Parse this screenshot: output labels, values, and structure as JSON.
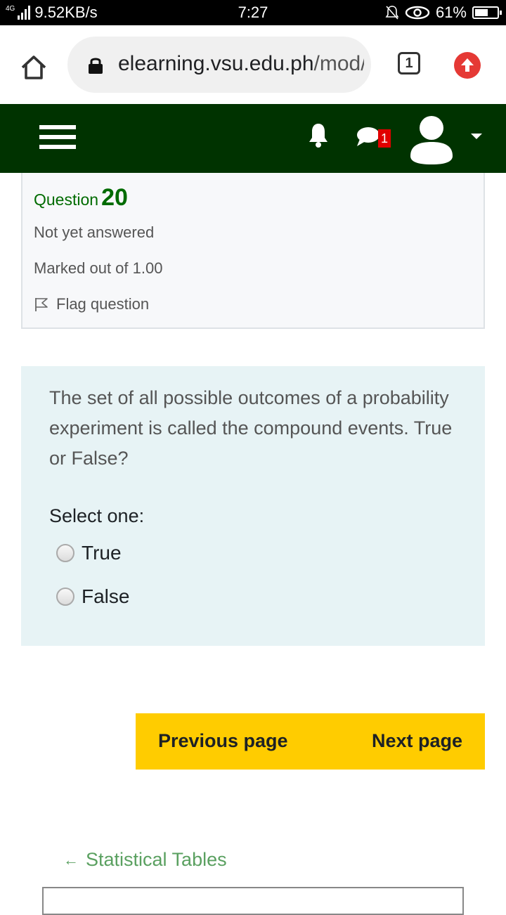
{
  "status_bar": {
    "network_type": "4G",
    "speed": "9.52KB/s",
    "time": "7:27",
    "battery": "61%",
    "battery_level": 0.61
  },
  "browser": {
    "url_host": "elearning.vsu.edu.ph",
    "url_path": "/mod/q",
    "tab_count": "1",
    "update_color": "#e53935"
  },
  "navbar": {
    "bg_color": "#003300",
    "message_badge": "1"
  },
  "question_info": {
    "label": "Question",
    "number": "20",
    "state": "Not yet answered",
    "marked": "Marked out of 1.00",
    "flag": "Flag question"
  },
  "question": {
    "text": "The set of all possible outcomes of a probability experiment is called the compound events. True or False?",
    "prompt": "Select one:",
    "options": [
      "True",
      "False"
    ]
  },
  "navigation": {
    "previous": "Previous page",
    "next": "Next page",
    "activity_link_arrow": "←",
    "activity_link": "Statistical Tables"
  },
  "colors": {
    "accent_green": "#006b00",
    "pager_yellow": "#ffcc00",
    "link_green": "#5aa060"
  }
}
